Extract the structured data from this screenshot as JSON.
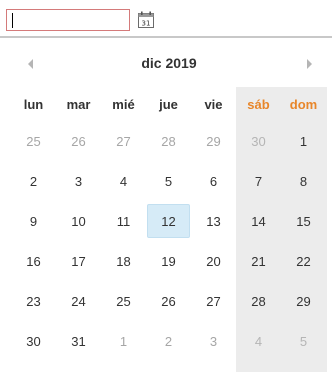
{
  "input": {
    "value": "",
    "placeholder": ""
  },
  "icons": {
    "calendar_icon": "calendar-icon",
    "prev": "chevron-left-icon",
    "next": "chevron-right-icon"
  },
  "calendar": {
    "month_label": "dic 2019",
    "weekdays": [
      "lun",
      "mar",
      "mié",
      "jue",
      "vie",
      "sáb",
      "dom"
    ],
    "selected_day": "12",
    "weeks": [
      [
        {
          "d": "25",
          "other": true
        },
        {
          "d": "26",
          "other": true
        },
        {
          "d": "27",
          "other": true
        },
        {
          "d": "28",
          "other": true
        },
        {
          "d": "29",
          "other": true
        },
        {
          "d": "30",
          "other": true
        },
        {
          "d": "1",
          "other": false
        }
      ],
      [
        {
          "d": "2",
          "other": false
        },
        {
          "d": "3",
          "other": false
        },
        {
          "d": "4",
          "other": false
        },
        {
          "d": "5",
          "other": false
        },
        {
          "d": "6",
          "other": false
        },
        {
          "d": "7",
          "other": false
        },
        {
          "d": "8",
          "other": false
        }
      ],
      [
        {
          "d": "9",
          "other": false
        },
        {
          "d": "10",
          "other": false
        },
        {
          "d": "11",
          "other": false
        },
        {
          "d": "12",
          "other": false,
          "selected": true
        },
        {
          "d": "13",
          "other": false
        },
        {
          "d": "14",
          "other": false
        },
        {
          "d": "15",
          "other": false
        }
      ],
      [
        {
          "d": "16",
          "other": false
        },
        {
          "d": "17",
          "other": false
        },
        {
          "d": "18",
          "other": false
        },
        {
          "d": "19",
          "other": false
        },
        {
          "d": "20",
          "other": false
        },
        {
          "d": "21",
          "other": false
        },
        {
          "d": "22",
          "other": false
        }
      ],
      [
        {
          "d": "23",
          "other": false
        },
        {
          "d": "24",
          "other": false
        },
        {
          "d": "25",
          "other": false
        },
        {
          "d": "26",
          "other": false
        },
        {
          "d": "27",
          "other": false
        },
        {
          "d": "28",
          "other": false
        },
        {
          "d": "29",
          "other": false
        }
      ],
      [
        {
          "d": "30",
          "other": false
        },
        {
          "d": "31",
          "other": false
        },
        {
          "d": "1",
          "other": true
        },
        {
          "d": "2",
          "other": true
        },
        {
          "d": "3",
          "other": true
        },
        {
          "d": "4",
          "other": true
        },
        {
          "d": "5",
          "other": true
        }
      ]
    ]
  },
  "colors": {
    "weekend_header": "#e8862a",
    "selected_bg": "#d6ebf7",
    "weekend_bg": "#ececec",
    "input_border": "#d47a7a"
  }
}
